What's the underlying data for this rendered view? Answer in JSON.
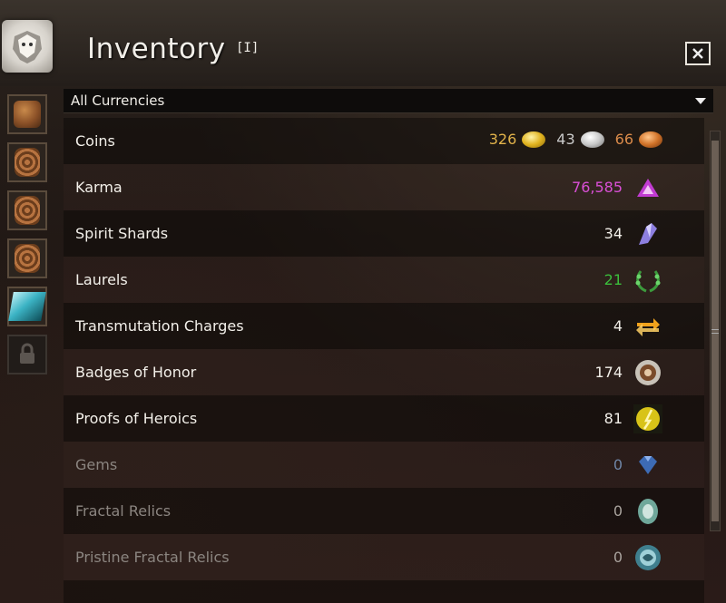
{
  "window": {
    "title": "Inventory",
    "hotkey": "[I]",
    "close_icon": "close-icon"
  },
  "filter": {
    "selected": "All Currencies"
  },
  "tabs": [
    {
      "name": "backpack-icon"
    },
    {
      "name": "bag-icon"
    },
    {
      "name": "bag-icon"
    },
    {
      "name": "bag-icon"
    },
    {
      "name": "crystal-bag-icon"
    },
    {
      "name": "lock-icon"
    }
  ],
  "currencies": [
    {
      "name": "Coins",
      "gold": "326",
      "silver": "43",
      "copper": "66",
      "dim": false
    },
    {
      "name": "Karma",
      "amount": "76,585",
      "color": "#d94fd6",
      "icon": "karma-icon",
      "dim": false
    },
    {
      "name": "Spirit Shards",
      "amount": "34",
      "color": "#f3f0ea",
      "icon": "spirit-shard-icon",
      "dim": false
    },
    {
      "name": "Laurels",
      "amount": "21",
      "color": "#3bbf3b",
      "icon": "laurel-icon",
      "dim": false
    },
    {
      "name": "Transmutation Charges",
      "amount": "4",
      "color": "#f3f0ea",
      "icon": "transmutation-icon",
      "dim": false
    },
    {
      "name": "Badges of Honor",
      "amount": "174",
      "color": "#f3f0ea",
      "icon": "badge-of-honor-icon",
      "dim": false
    },
    {
      "name": "Proofs of Heroics",
      "amount": "81",
      "color": "#f3f0ea",
      "icon": "proof-of-heroics-icon",
      "dim": false
    },
    {
      "name": "Gems",
      "amount": "0",
      "color": "#6f86a8",
      "icon": "gem-icon",
      "dim": true
    },
    {
      "name": "Fractal Relics",
      "amount": "0",
      "color": "#a9a39d",
      "icon": "fractal-relic-icon",
      "dim": true
    },
    {
      "name": "Pristine Fractal Relics",
      "amount": "0",
      "color": "#a9a39d",
      "icon": "pristine-fractal-relic-icon",
      "dim": true
    }
  ],
  "colors": {
    "gold": "#e2b34a",
    "silver": "#c9c9c9",
    "copper": "#d98a4a"
  }
}
